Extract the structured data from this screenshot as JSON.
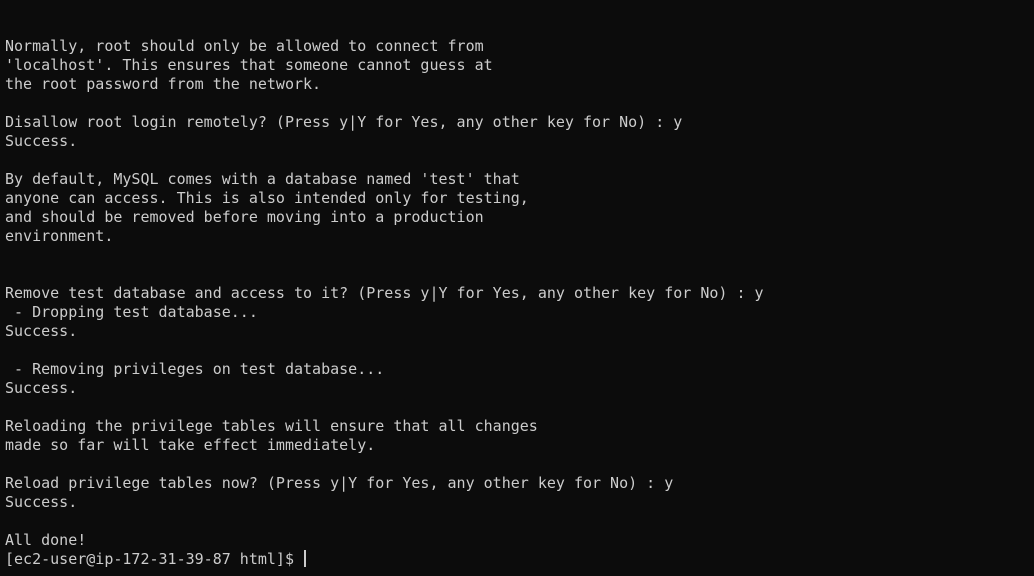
{
  "terminal": {
    "lines": [
      "Normally, root should only be allowed to connect from",
      "'localhost'. This ensures that someone cannot guess at",
      "the root password from the network.",
      "",
      "Disallow root login remotely? (Press y|Y for Yes, any other key for No) : y",
      "Success.",
      "",
      "By default, MySQL comes with a database named 'test' that",
      "anyone can access. This is also intended only for testing,",
      "and should be removed before moving into a production",
      "environment.",
      "",
      "",
      "Remove test database and access to it? (Press y|Y for Yes, any other key for No) : y",
      " - Dropping test database...",
      "Success.",
      "",
      " - Removing privileges on test database...",
      "Success.",
      "",
      "Reloading the privilege tables will ensure that all changes",
      "made so far will take effect immediately.",
      "",
      "Reload privilege tables now? (Press y|Y for Yes, any other key for No) : y",
      "Success.",
      "",
      "All done!"
    ],
    "prompt": "[ec2-user@ip-172-31-39-87 html]$ ",
    "colors": {
      "background": "#0c0c0c",
      "foreground": "#cccccc"
    }
  }
}
